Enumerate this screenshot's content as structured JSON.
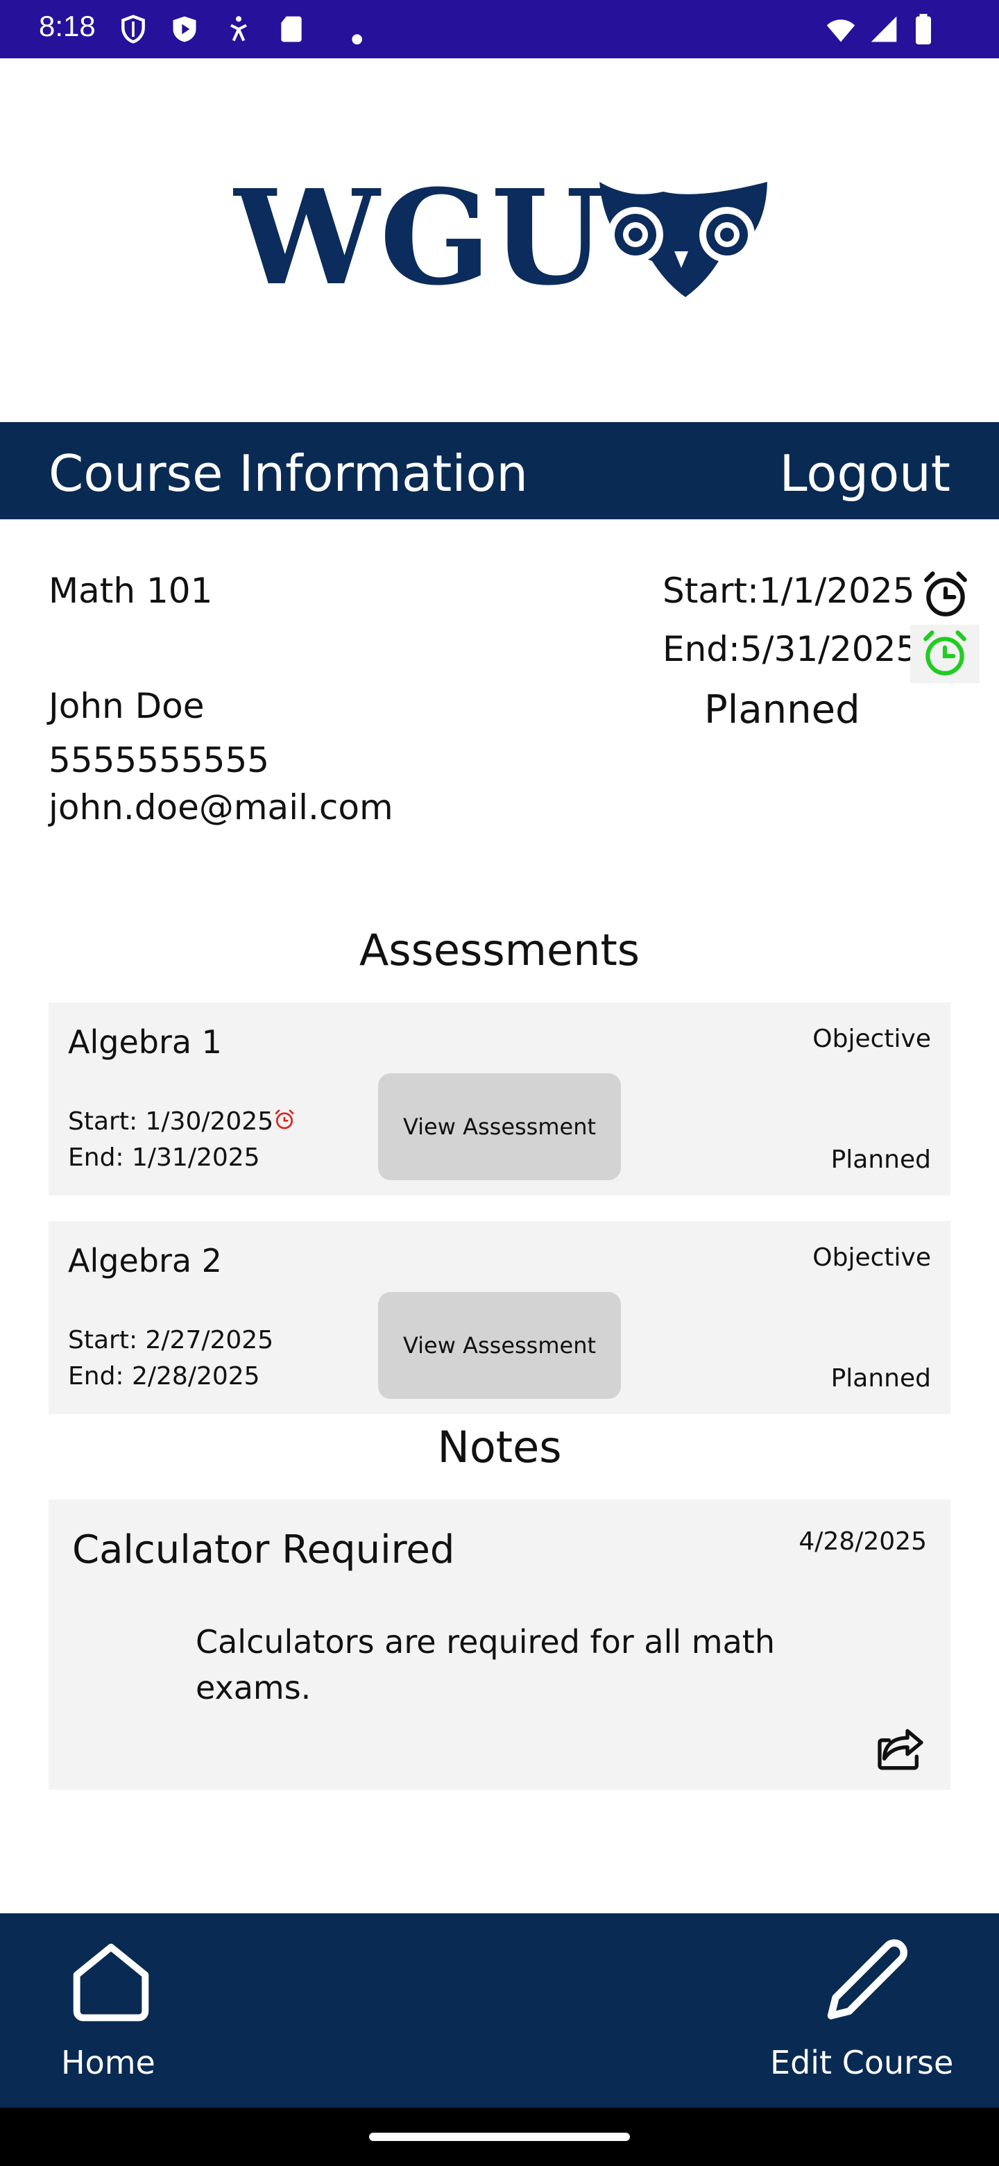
{
  "status_bar": {
    "time": "8:18"
  },
  "logo": {
    "text": "WGU"
  },
  "header": {
    "title": "Course Information",
    "logout_label": "Logout"
  },
  "course": {
    "name": "Math 101",
    "start": "Start:1/1/2025",
    "end": "End:5/31/2025",
    "status": "Planned",
    "instructor": {
      "name": "John Doe",
      "phone": "5555555555",
      "email": "john.doe@mail.com"
    }
  },
  "assessments": {
    "title": "Assessments",
    "items": [
      {
        "name": "Algebra 1",
        "type": "Objective",
        "start": "Start: 1/30/2025",
        "end": "End: 1/31/2025",
        "status": "Planned",
        "button": "View Assessment",
        "has_alarm": true
      },
      {
        "name": "Algebra 2",
        "type": "Objective",
        "start": "Start: 2/27/2025",
        "end": "End: 2/28/2025",
        "status": "Planned",
        "button": "View Assessment",
        "has_alarm": false
      }
    ]
  },
  "notes": {
    "title": "Notes",
    "items": [
      {
        "title": "Calculator Required",
        "date": "4/28/2025",
        "body": "Calculators are required for all math exams."
      }
    ]
  },
  "bottom_nav": {
    "home_label": "Home",
    "edit_label": "Edit Course"
  },
  "colors": {
    "status_bar": "#25119a",
    "brand_navy": "#092a53",
    "alarm_start": "#111111",
    "alarm_end": "#22cc22",
    "alarm_assessment": "#e02020"
  },
  "icons": [
    "shield-icon",
    "play-icon",
    "accessibility-icon",
    "sd-card-icon",
    "wifi-icon",
    "signal-icon",
    "battery-icon",
    "alarm-clock-icon",
    "share-icon",
    "home-icon",
    "pencil-icon"
  ]
}
